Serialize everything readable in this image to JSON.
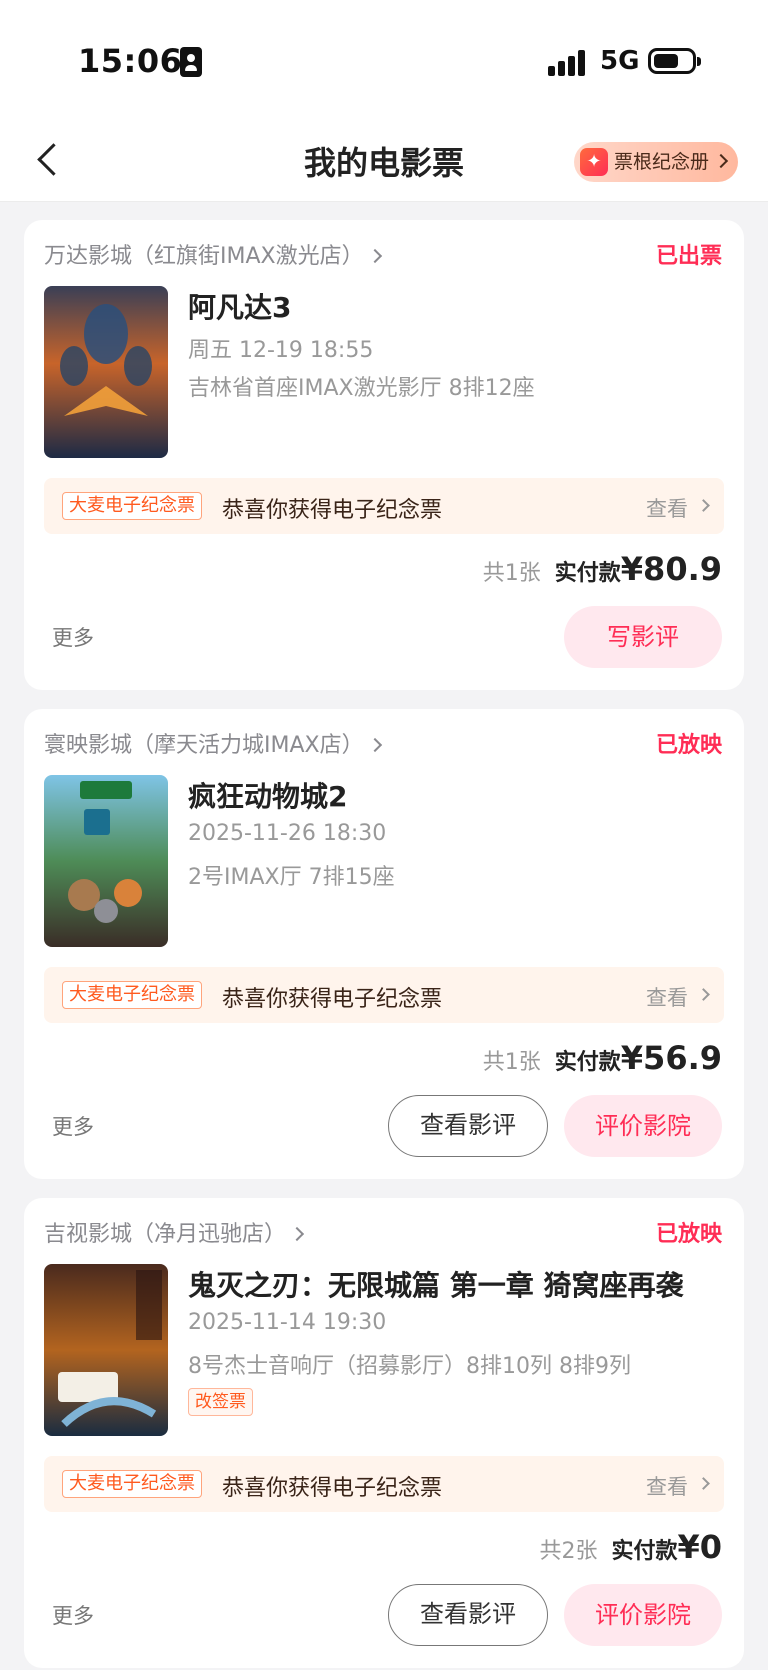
{
  "status_bar": {
    "time": "15:06",
    "network": "5G"
  },
  "nav": {
    "title": "我的电影票",
    "album_label": "票根纪念册"
  },
  "colors": {
    "accent": "#ff2d55",
    "souvenir_bg": "#fff4ec"
  },
  "orders": [
    {
      "cinema": "万达影城（红旗街IMAX激光店）",
      "status": "已出票",
      "title": "阿凡达3",
      "showtime": "周五 12-19 18:55",
      "hall": "吉林省首座IMAX激光影厅 8排12座",
      "souvenir_badge": "大麦电子纪念票",
      "souvenir_text": "恭喜你获得电子纪念票",
      "souvenir_view": "查看",
      "count": "共1张",
      "pay_label": "实付款",
      "amount": "¥80.9",
      "more": "更多",
      "primary_button": "写影评"
    },
    {
      "cinema": "寰映影城（摩天活力城IMAX店）",
      "status": "已放映",
      "title": "疯狂动物城2",
      "showtime": "2025-11-26 18:30",
      "hall": "2号IMAX厅 7排15座",
      "souvenir_badge": "大麦电子纪念票",
      "souvenir_text": "恭喜你获得电子纪念票",
      "souvenir_view": "查看",
      "count": "共1张",
      "pay_label": "实付款",
      "amount": "¥56.9",
      "more": "更多",
      "secondary_button": "查看影评",
      "primary_button": "评价影院"
    },
    {
      "cinema": "吉视影城（净月迅驰店）",
      "status": "已放映",
      "title": "鬼灭之刃：无限城篇 第一章 猗窝座再袭",
      "showtime": "2025-11-14 19:30",
      "hall": "8号杰士音响厅（招募影厅）8排10列 8排9列",
      "tag": "改签票",
      "souvenir_badge": "大麦电子纪念票",
      "souvenir_text": "恭喜你获得电子纪念票",
      "souvenir_view": "查看",
      "count": "共2张",
      "pay_label": "实付款",
      "amount": "¥0",
      "more": "更多",
      "secondary_button": "查看影评",
      "primary_button": "评价影院"
    }
  ]
}
